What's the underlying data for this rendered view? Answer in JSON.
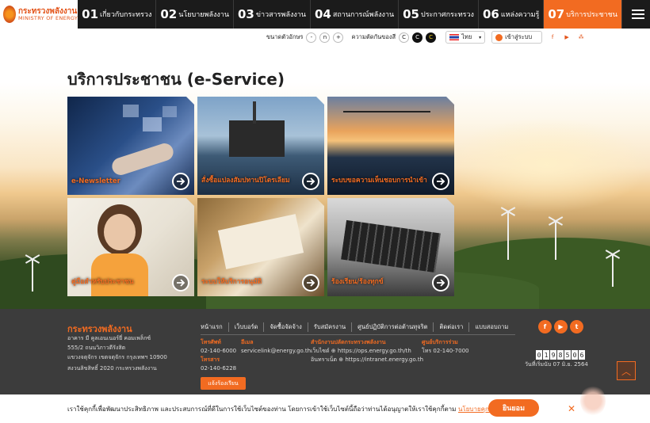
{
  "logo": {
    "th": "กระทรวงพลังงาน",
    "en": "MINISTRY OF ENERGY"
  },
  "menu": [
    {
      "num": "01",
      "label": "เกี่ยวกับกระทรวง"
    },
    {
      "num": "02",
      "label": "นโยบายพลังงาน"
    },
    {
      "num": "03",
      "label": "ข่าวสารพลังงาน"
    },
    {
      "num": "04",
      "label": "สถานการณ์พลังงาน"
    },
    {
      "num": "05",
      "label": "ประกาศกระทรวง"
    },
    {
      "num": "06",
      "label": "แหล่งความรู้"
    },
    {
      "num": "07",
      "label": "บริการประชาชน"
    }
  ],
  "toolbar": {
    "font_size_label": "ขนาดตัวอักษร",
    "minus": "-",
    "normal": "n",
    "plus": "+",
    "contrast_label": "ความตัดกันของสี",
    "c1": "C",
    "c2": "C",
    "c3": "C",
    "language": "ไทย",
    "login": "เข้าสู่ระบบ"
  },
  "page_title": "บริการประชาชน (e-Service)",
  "cards": [
    {
      "caption": "e-Newsletter"
    },
    {
      "caption": "สั่งซื้อแปลงสัมปทานปิโตรเลียม"
    },
    {
      "caption": "ระบบขอความเห็นชอบการนำเข้า"
    },
    {
      "caption": "คู่มือสำหรับประชาชน"
    },
    {
      "caption": "ระบบให้บริการอนุมัติ"
    },
    {
      "caption": "ร้องเรียน/ร้องทุกข์"
    }
  ],
  "footer": {
    "name": "กระทรวงพลังงาน",
    "addr1": "อาคาร มี คูลเอนเนอร์ยี่ คอมเพล็กซ์",
    "addr2": "555/2 ถนนวิภาวดีรังสิต",
    "addr3": "แขวงจตุจักร เขตจตุจักร กรุงเทพฯ 10900",
    "copyright": "สงวนลิขสิทธิ์ 2020 กระทรวงพลังงาน",
    "links": [
      "หน้าแรก",
      "เว็บบอร์ด",
      "จัดซื้อจัดจ้าง",
      "รับสมัครงาน",
      "ศูนย์ปฏิบัติการต่อต้านทุจริต",
      "ติดต่อเรา",
      "แบบสอบถาม"
    ],
    "phone_h": "โทรศัพท์",
    "phone": "02-140-6000",
    "fax_h": "โทรสาร",
    "fax": "02-140-6228",
    "email_h": "อีเมล",
    "email": "servicelink@energy.go.th",
    "office_h": "สำนักงานปลัดกระทรวงพลังงาน",
    "office_web": "เว็บไซต์ ⊕ https://ops.energy.go.th/th",
    "office_intra": "อินทราเน็ต ⊕ https://intranet.energy.go.th",
    "center_h": "ศูนย์บริการร่วม",
    "center_phone": "โทร 02-140-7000",
    "complain": "แจ้งร้องเรียน",
    "counter": [
      "0",
      "1",
      "9",
      "8",
      "5",
      "0",
      "6"
    ],
    "since": "วันที่เริ่มนับ 07 มิ.ย. 2564"
  },
  "cookie": {
    "text": "เราใช้คุกกี้เพื่อพัฒนาประสิทธิภาพ และประสบการณ์ที่ดีในการใช้เว็บไซต์ของท่าน โดยการเข้าใช้เว็บไซต์นี้ถือว่าท่านได้อนุญาตให้เราใช้คุกกี้ตาม ",
    "link": "นโยบายคุกกี้",
    "accept": "ยินยอม"
  }
}
